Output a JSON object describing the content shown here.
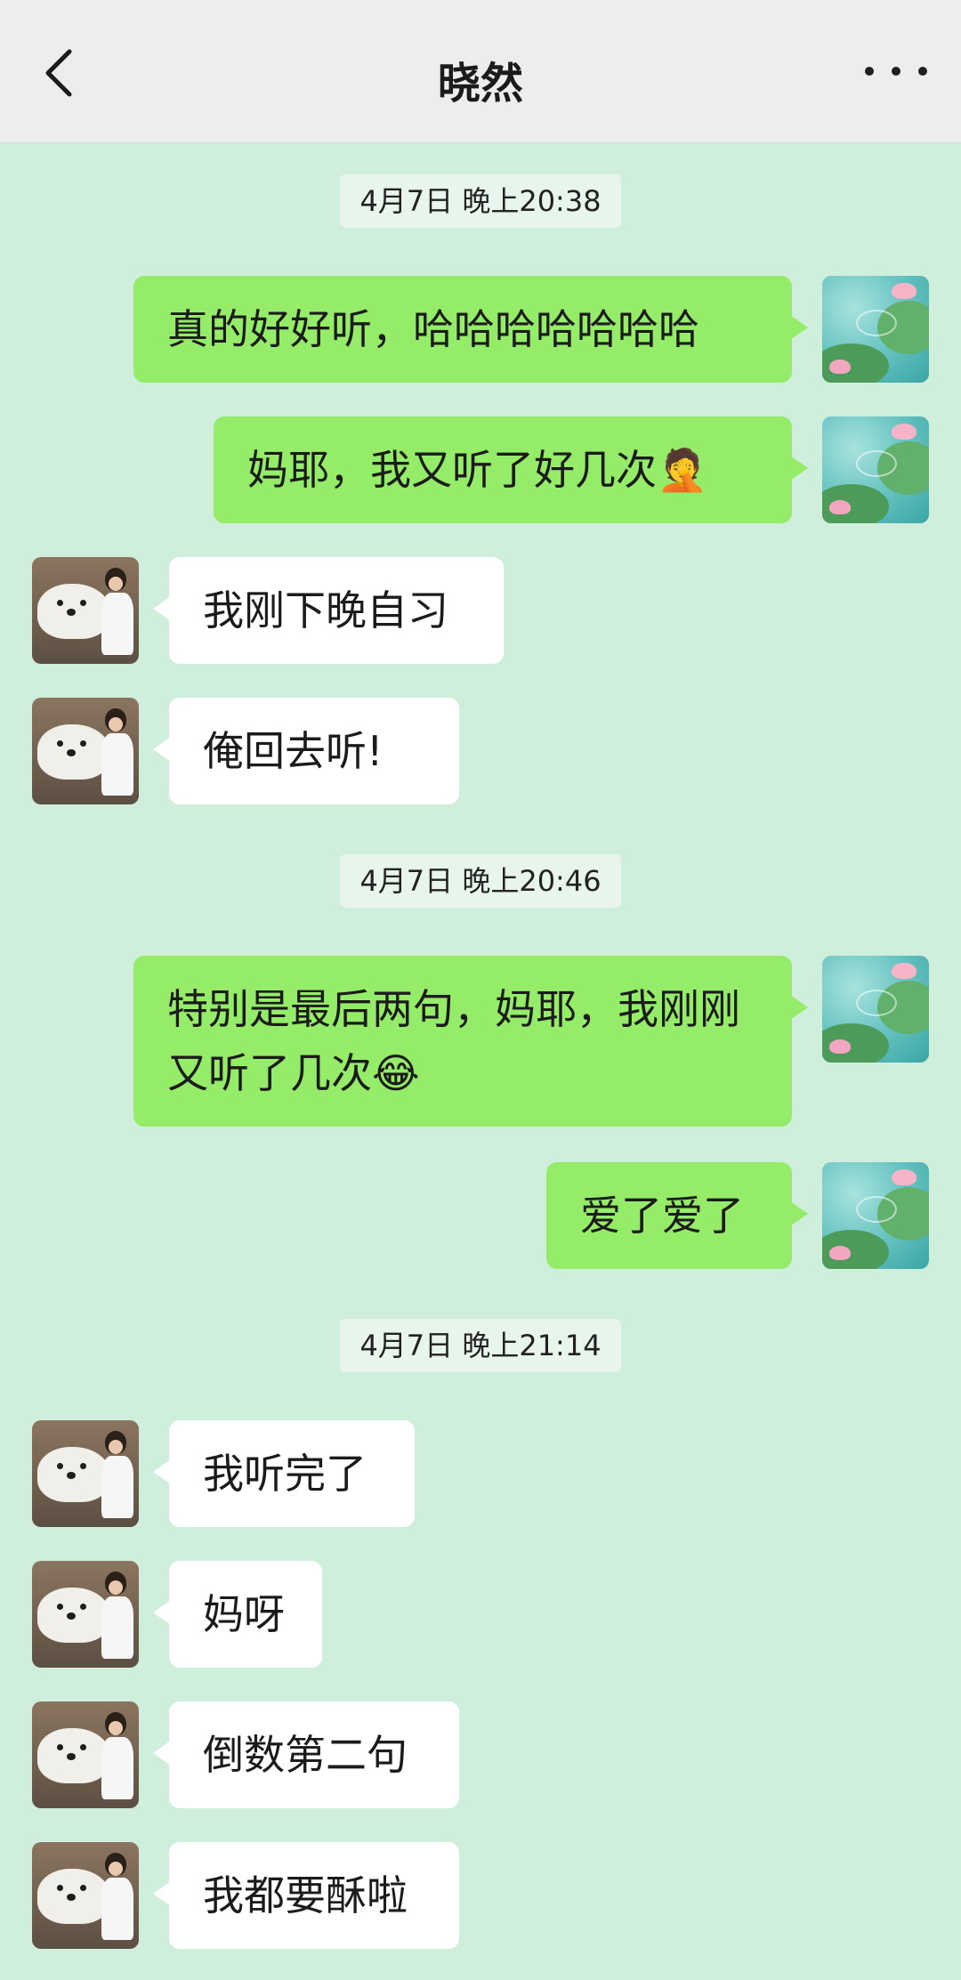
{
  "header": {
    "title": "晓然",
    "back_icon": "chevron-left-icon",
    "more_icon": "more-horizontal-icon"
  },
  "timestamps": [
    "4月7日 晚上20:38",
    "4月7日 晚上20:46",
    "4月7日 晚上21:14"
  ],
  "messages": [
    {
      "from": "self",
      "text": "真的好好听，哈哈哈哈哈哈哈"
    },
    {
      "from": "self",
      "text": "妈耶，我又听了好几次🤦"
    },
    {
      "from": "peer",
      "text": "我刚下晚自习"
    },
    {
      "from": "peer",
      "text": "俺回去听!"
    },
    {
      "from": "self",
      "text": "特别是最后两句，妈耶，我刚刚又听了几次😂"
    },
    {
      "from": "self",
      "text": "爱了爱了"
    },
    {
      "from": "peer",
      "text": "我听完了"
    },
    {
      "from": "peer",
      "text": "妈呀"
    },
    {
      "from": "peer",
      "text": "倒数第二句"
    },
    {
      "from": "peer",
      "text": "我都要酥啦"
    }
  ],
  "colors": {
    "background": "#cfeedb",
    "self_bubble": "#95ec69",
    "peer_bubble": "#ffffff",
    "topbar": "#ededed"
  }
}
